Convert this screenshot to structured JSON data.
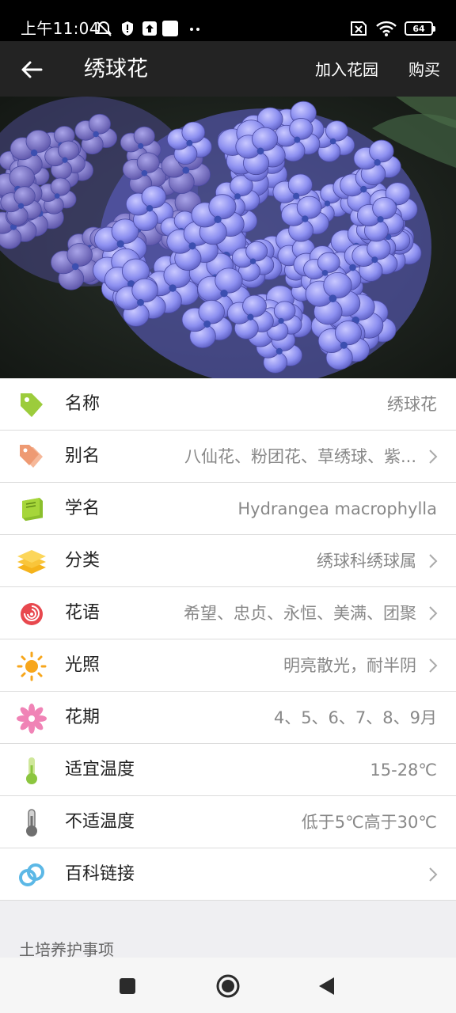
{
  "status_bar": {
    "time": "上午11:04",
    "battery": "64",
    "icons": [
      "mute-alarm-icon",
      "shield-alert-icon",
      "upload-icon",
      "notification-square-icon",
      "more-dots-icon",
      "sim-off-icon",
      "wifi-icon",
      "battery-icon"
    ]
  },
  "header": {
    "title": "绣球花",
    "back_icon": "back-arrow-icon",
    "add_garden": "加入花园",
    "buy": "购买",
    "bg_color": "#232323"
  },
  "hero": {
    "subject": "hydrangea-photo",
    "flower_color": "#8c8ff0"
  },
  "info_rows": [
    {
      "id": "name",
      "icon": "tag-icon",
      "label": "名称",
      "value": "绣球花",
      "arrow": false
    },
    {
      "id": "alias",
      "icon": "tags-icon",
      "label": "别名",
      "value": "八仙花、粉团花、草绣球、紫...",
      "arrow": true
    },
    {
      "id": "scientific",
      "icon": "book-icon",
      "label": "学名",
      "value": "Hydrangea macrophylla",
      "arrow": false
    },
    {
      "id": "category",
      "icon": "layers-icon",
      "label": "分类",
      "value": "绣球科绣球属",
      "arrow": true
    },
    {
      "id": "language",
      "icon": "rose-icon",
      "label": "花语",
      "value": "希望、忠贞、永恒、美满、团聚",
      "arrow": true
    },
    {
      "id": "light",
      "icon": "sun-icon",
      "label": "光照",
      "value": "明亮散光，耐半阴",
      "arrow": true
    },
    {
      "id": "bloom",
      "icon": "flower-icon",
      "label": "花期",
      "value": "4、5、6、7、8、9月",
      "arrow": false
    },
    {
      "id": "temp_ok",
      "icon": "thermometer-green-icon",
      "label": "适宜温度",
      "value": "15-28℃",
      "arrow": false
    },
    {
      "id": "temp_bad",
      "icon": "thermometer-gray-icon",
      "label": "不适温度",
      "value": "低于5℃高于30℃",
      "arrow": false
    },
    {
      "id": "wiki",
      "icon": "link-icon",
      "label": "百科链接",
      "value": "",
      "arrow": true
    }
  ],
  "section": {
    "title": "土培养护事项"
  },
  "nav": {
    "icons": [
      "recent-apps-icon",
      "home-icon",
      "back-triangle-icon"
    ]
  }
}
